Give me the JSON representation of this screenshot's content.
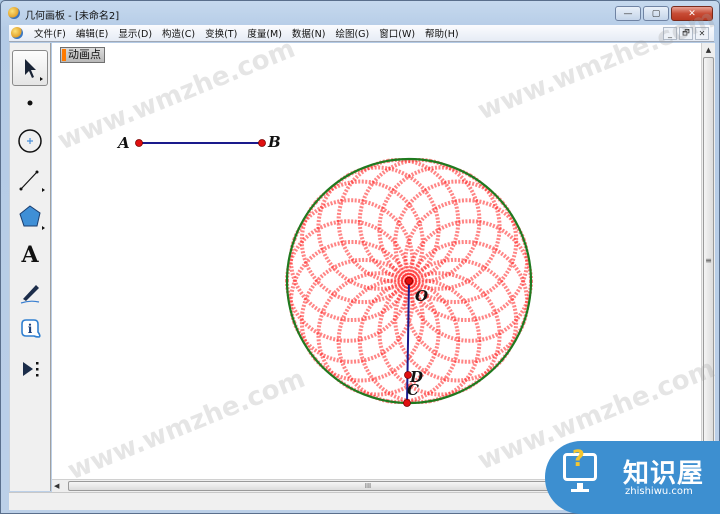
{
  "window": {
    "title": "几何画板 - [未命名2]",
    "buttons": {
      "minimize": "—",
      "maximize": "▢",
      "close": "✕"
    }
  },
  "menubar": {
    "items": [
      {
        "label": "文件(F)"
      },
      {
        "label": "编辑(E)"
      },
      {
        "label": "显示(D)"
      },
      {
        "label": "构造(C)"
      },
      {
        "label": "变换(T)"
      },
      {
        "label": "度量(M)"
      },
      {
        "label": "数据(N)"
      },
      {
        "label": "绘图(G)"
      },
      {
        "label": "窗口(W)"
      },
      {
        "label": "帮助(H)"
      }
    ],
    "mdi_buttons": {
      "minimize": "_",
      "restore": "🗗",
      "close": "✕"
    }
  },
  "toolbox": {
    "tools": [
      {
        "name": "arrow-select-tool",
        "selected": true
      },
      {
        "name": "point-tool"
      },
      {
        "name": "compass-tool"
      },
      {
        "name": "straightedge-tool"
      },
      {
        "name": "polygon-tool"
      },
      {
        "name": "text-tool",
        "glyph": "A"
      },
      {
        "name": "marker-tool"
      },
      {
        "name": "information-tool",
        "glyph": "i"
      },
      {
        "name": "custom-tool"
      }
    ]
  },
  "canvas": {
    "action_button": "动画点",
    "points": {
      "A": "A",
      "B": "B",
      "O": "O",
      "C": "C",
      "D": "D"
    },
    "colors": {
      "segment": "#1a1a8c",
      "point": "#e01010",
      "circle": "#1f7a1f",
      "trace": "#ff2020"
    }
  },
  "scrollbars": {
    "h_grip": "III",
    "v_grip": "≡",
    "up": "▲",
    "left": "◀"
  },
  "watermarks": [
    "www.wmzhe.com"
  ],
  "badge": {
    "brand": "知识屋",
    "site": "zhishiwu.com",
    "question": "?"
  }
}
